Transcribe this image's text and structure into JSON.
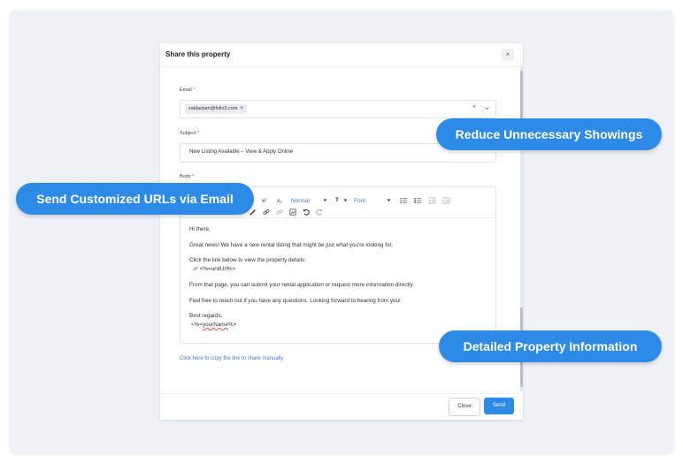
{
  "modal": {
    "title": "Share this property",
    "close_glyph": "×"
  },
  "email": {
    "label": "Email",
    "required_mark": "*",
    "chip": "zaidaslam@folio3.com",
    "chip_remove": "×",
    "clear": "×",
    "chevron_icon": "chevron-down-icon"
  },
  "subject": {
    "label": "Subject",
    "required_mark": "*",
    "value": "New Listing Available – View & Apply Online"
  },
  "body": {
    "label": "Body",
    "required_mark": "*",
    "toolbar": {
      "superscript": "x²",
      "subscript": "x₂",
      "heading_select": "Normal",
      "font_size": "T",
      "font_select": "Font",
      "icons": [
        "superscript-icon",
        "subscript-icon",
        "bullet-list-icon",
        "numbered-list-icon",
        "outdent-icon",
        "indent-icon",
        "pen-icon",
        "link-icon",
        "unlink-icon",
        "image-icon",
        "undo-icon",
        "redo-icon"
      ]
    },
    "lines": {
      "greeting": "Hi there,",
      "intro": "Great news! We have a new rental listing that might be just what you're looking for.",
      "click": "Click the link below to view the property details:",
      "unit_url": "<%=unitUrl%>",
      "apply": "From that page, you can submit your rental application or request more information directly.",
      "questions": "Feel free to reach out if you have any questions. Looking forward to hearing from you!",
      "regards": "Best regards,",
      "name_open": "<%=",
      "name_var": "yourName",
      "name_close": "%>"
    }
  },
  "copy_link": "Click here to copy the link to share manually",
  "footer": {
    "close_label": "Close",
    "send_label": "Send"
  },
  "callouts": {
    "reduce": "Reduce Unnecessary Showings",
    "send_urls": "Send Customized URLs via Email",
    "detailed": "Detailed Property Information"
  },
  "colors": {
    "accent": "#2d8ae6",
    "link": "#3b7ddd",
    "required": "#d9534f"
  }
}
